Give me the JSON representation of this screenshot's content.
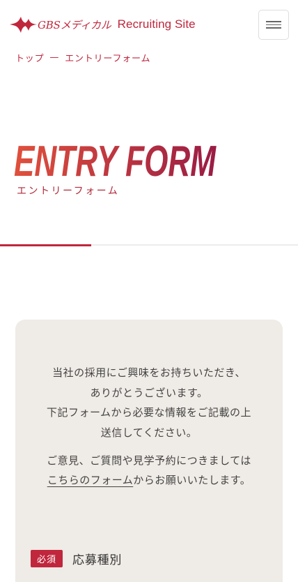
{
  "header": {
    "brand": "GBSメディカル",
    "site_name": "Recruiting Site",
    "logo_icon": "star-logo-icon",
    "menu_icon": "hamburger-menu-icon"
  },
  "breadcrumb": {
    "home": "トップ",
    "separator": "—",
    "current": "エントリーフォーム"
  },
  "hero": {
    "title": "ENTRY FORM",
    "subtitle": "エントリーフォーム"
  },
  "intro": {
    "lines": [
      "当社の採用にご興味をお持ちいただき、",
      "ありがとうございます。",
      "下記フォームから必要な情報をご記載の上",
      "送信してください。"
    ],
    "note_line1": "ご意見、ご質問や見学予約につきましては",
    "note_link": "こちらのフォーム",
    "note_rest": "からお願いいたします。"
  },
  "form": {
    "required_badge": "必須",
    "field_label": "応募種別"
  },
  "colors": {
    "accent": "#c0263c",
    "card_bg": "#efebe6",
    "gradient_start": "#e0503c",
    "gradient_end": "#9a1c44"
  }
}
